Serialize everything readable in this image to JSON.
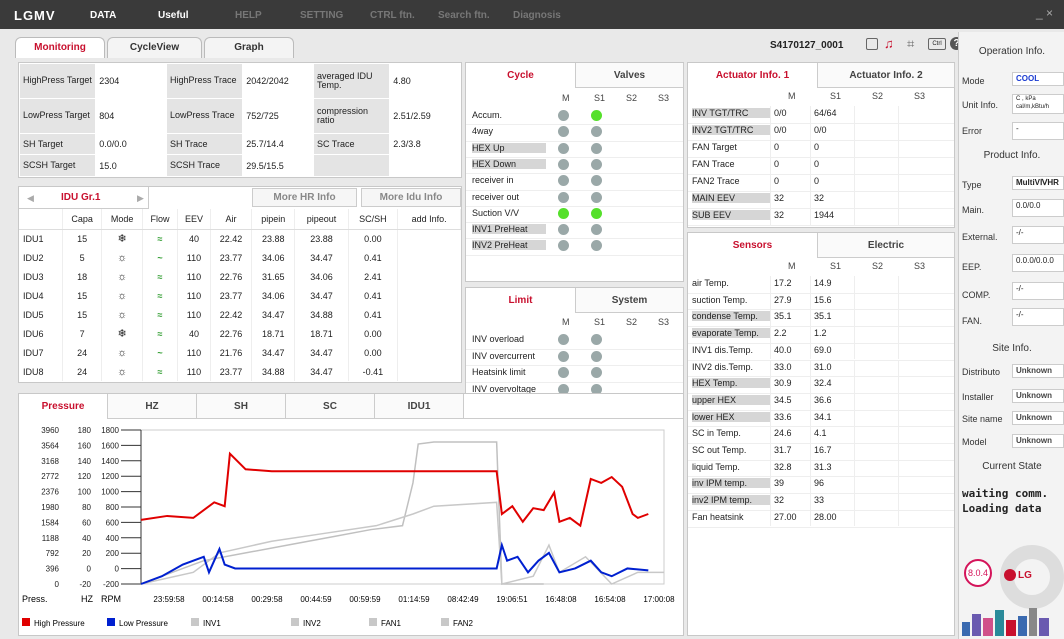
{
  "menu": {
    "logo": "LGMV",
    "items": [
      "DATA",
      "Useful",
      "HELP",
      "SETTING",
      "CTRL ftn.",
      "Search ftn.",
      "Diagnosis"
    ],
    "close": "_ ×"
  },
  "tabs": [
    "Monitoring",
    "CycleView",
    "Graph"
  ],
  "device_id": "S4170127_0001",
  "targets": [
    [
      "HighPress Target",
      "2304",
      "HighPress Trace",
      "2042/2042",
      "averaged IDU Temp.",
      "4.80"
    ],
    [
      "LowPress Target",
      "804",
      "LowPress Trace",
      "752/725",
      "compression ratio",
      "2.51/2.59"
    ],
    [
      "SH Target",
      "0.0/0.0",
      "SH Trace",
      "25.7/14.4",
      "SC Trace",
      "2.3/3.8"
    ],
    [
      "SCSH Target",
      "15.0",
      "SCSH Trace",
      "29.5/15.5",
      "",
      ""
    ]
  ],
  "idu": {
    "group": "IDU Gr.1",
    "more_hr": "More HR Info",
    "more_idu": "More Idu Info",
    "headers": [
      "",
      "Capa",
      "Mode",
      "Flow",
      "EEV",
      "Air",
      "pipein",
      "pipeout",
      "SC/SH",
      "add Info."
    ],
    "rows": [
      [
        "IDU1",
        "15",
        "❄",
        "≈",
        "40",
        "22.42",
        "23.88",
        "23.88",
        "0.00"
      ],
      [
        "IDU2",
        "5",
        "☼",
        "~",
        "110",
        "23.77",
        "34.06",
        "34.47",
        "0.41"
      ],
      [
        "IDU3",
        "18",
        "☼",
        "≈",
        "110",
        "22.76",
        "31.65",
        "34.06",
        "2.41"
      ],
      [
        "IDU4",
        "15",
        "☼",
        "≈",
        "110",
        "23.77",
        "34.06",
        "34.47",
        "0.41"
      ],
      [
        "IDU5",
        "15",
        "☼",
        "≈",
        "110",
        "22.42",
        "34.47",
        "34.88",
        "0.41"
      ],
      [
        "IDU6",
        "7",
        "❄",
        "≈",
        "40",
        "22.76",
        "18.71",
        "18.71",
        "0.00"
      ],
      [
        "IDU7",
        "24",
        "☼",
        "~",
        "110",
        "21.76",
        "34.47",
        "34.47",
        "0.00"
      ],
      [
        "IDU8",
        "24",
        "☼",
        "≈",
        "110",
        "23.77",
        "34.88",
        "34.47",
        "-0.41"
      ]
    ]
  },
  "cycle": {
    "tabs": [
      "Cycle",
      "Valves"
    ],
    "cols": [
      "M",
      "S1",
      "S2",
      "S3"
    ],
    "rows": [
      "Accum.",
      "4way",
      "HEX Up",
      "HEX Down",
      "receiver in",
      "receiver out",
      "Suction V/V",
      "INV1 PreHeat",
      "INV2 PreHeat"
    ]
  },
  "limit": {
    "tabs": [
      "Limit",
      "System"
    ],
    "cols": [
      "M",
      "S1",
      "S2",
      "S3"
    ],
    "rows": [
      "INV overload",
      "INV overcurrent",
      "Heatsink limit",
      "INV overvoltage"
    ]
  },
  "actuator": {
    "tabs": [
      "Actuator Info. 1",
      "Actuator Info. 2"
    ],
    "cols": [
      "M",
      "S1",
      "S2",
      "S3"
    ],
    "rows": [
      [
        "INV TGT/TRC",
        "0/0",
        "64/64"
      ],
      [
        "INV2 TGT/TRC",
        "0/0",
        "0/0"
      ],
      [
        "FAN Target",
        "0",
        "0"
      ],
      [
        "FAN Trace",
        "0",
        "0"
      ],
      [
        "FAN2 Trace",
        "0",
        "0"
      ],
      [
        "MAIN EEV",
        "32",
        "32"
      ],
      [
        "SUB EEV",
        "32",
        "1944"
      ]
    ]
  },
  "sensors": {
    "tabs": [
      "Sensors",
      "Electric"
    ],
    "cols": [
      "M",
      "S1",
      "S2",
      "S3"
    ],
    "rows": [
      [
        "air Temp.",
        "17.2",
        "14.9"
      ],
      [
        "suction Temp.",
        "27.9",
        "15.6"
      ],
      [
        "condense Temp.",
        "35.1",
        "35.1"
      ],
      [
        "evaporate Temp.",
        "2.2",
        "1.2"
      ],
      [
        "INV1 dis.Temp.",
        "40.0",
        "69.0"
      ],
      [
        "INV2 dis.Temp.",
        "33.0",
        "31.0"
      ],
      [
        "HEX Temp.",
        "30.9",
        "32.4"
      ],
      [
        "upper HEX",
        "34.5",
        "36.6"
      ],
      [
        "lower HEX",
        "33.6",
        "34.1"
      ],
      [
        "SC in Temp.",
        "24.6",
        "4.1"
      ],
      [
        "SC out Temp.",
        "31.7",
        "16.7"
      ],
      [
        "liquid Temp.",
        "32.8",
        "31.3"
      ],
      [
        "inv IPM temp.",
        "39",
        "96"
      ],
      [
        "inv2 IPM temp.",
        "32",
        "33"
      ],
      [
        "Fan heatsink",
        "27.00",
        "28.00"
      ]
    ]
  },
  "graph": {
    "tabs": [
      "Pressure",
      "HZ",
      "SH",
      "SC",
      "IDU1"
    ],
    "press_ticks": [
      "3960",
      "3564",
      "3168",
      "2772",
      "2376",
      "1980",
      "1584",
      "1188",
      "792",
      "396",
      "0"
    ],
    "hz_ticks": [
      "180",
      "160",
      "140",
      "120",
      "100",
      "80",
      "60",
      "40",
      "20",
      "0",
      "-20"
    ],
    "rpm_ticks": [
      "1800",
      "1600",
      "1400",
      "1200",
      "1000",
      "800",
      "600",
      "400",
      "200",
      "0",
      "-200"
    ],
    "axis_labels": [
      "Press.",
      "HZ",
      "RPM"
    ],
    "x_ticks": [
      "23:59:58",
      "00:14:58",
      "00:29:58",
      "00:44:59",
      "00:59:59",
      "01:14:59",
      "08:42:49",
      "19:06:51",
      "16:48:08",
      "16:54:08",
      "17:00:08"
    ],
    "legend": [
      {
        "name": "High Pressure",
        "color": "#e00000"
      },
      {
        "name": "Low Pressure",
        "color": "#0020d0"
      },
      {
        "name": "INV1",
        "color": "#c8c8c8"
      },
      {
        "name": "INV2",
        "color": "#c8c8c8"
      },
      {
        "name": "FAN1",
        "color": "#c8c8c8"
      },
      {
        "name": "FAN2",
        "color": "#c8c8c8"
      }
    ]
  },
  "right": {
    "operation_title": "Operation Info.",
    "mode_label": "Mode",
    "mode_value": "COOL",
    "unit_label": "Unit Info.",
    "unit_value": "C , kPa cal/m,kBtu/h",
    "error_label": "Error",
    "error_value": "-",
    "product_title": "Product Info.",
    "type_label": "Type",
    "type_value": "MultiVⅣHR",
    "main_label": "Main.",
    "main_value": "0.0/0.0",
    "external_label": "External.",
    "external_value": "-/-",
    "eep_label": "EEP.",
    "eep_value": "0.0.0/0.0.0",
    "comp_label": "COMP.",
    "comp_value": "-/-",
    "fan_label": "FAN.",
    "fan_value": "-/-",
    "site_title": "Site Info.",
    "distributor_label": "Distributo",
    "distributor_value": "Unknown",
    "installer_label": "Installer",
    "installer_value": "Unknown",
    "site_label": "Site name",
    "site_value": "Unknown",
    "model_label": "Model",
    "model_value": "Unknown",
    "state_title": "Current State",
    "state_text1": "waiting comm.",
    "state_text2": "Loading data",
    "version": "8.0.4",
    "brand": "LG"
  }
}
